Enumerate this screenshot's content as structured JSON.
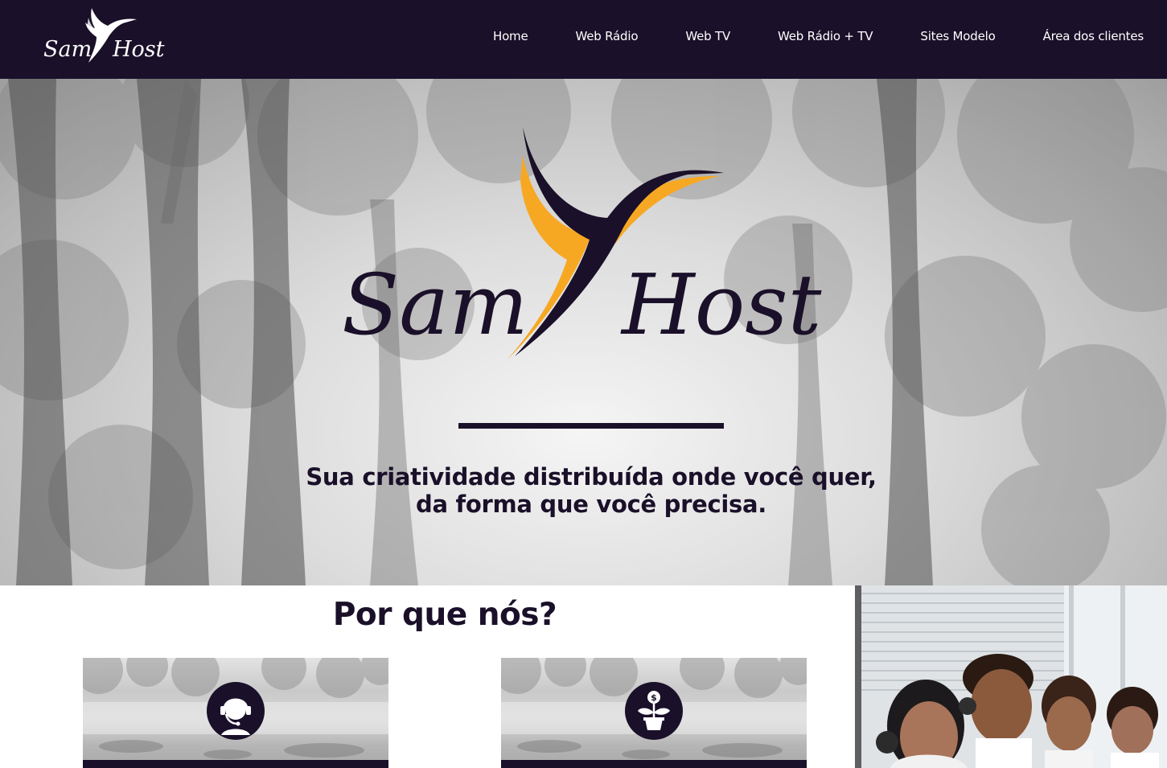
{
  "nav": {
    "logo_text": [
      "Sam",
      "Host"
    ],
    "links": [
      {
        "label": "Home"
      },
      {
        "label": "Web Rádio"
      },
      {
        "label": "Web TV"
      },
      {
        "label": "Web Rádio + TV"
      },
      {
        "label": "Sites Modelo"
      },
      {
        "label": "Área dos clientes"
      }
    ]
  },
  "hero": {
    "logo_text": [
      "Sam",
      "Host"
    ],
    "tagline_line1": "Sua criatividade distribuída onde você quer,",
    "tagline_line2": "da forma que você precisa."
  },
  "why": {
    "title": "Por que nós?",
    "features": [
      {
        "icon": "headset-support-icon"
      },
      {
        "icon": "money-plant-icon"
      }
    ]
  },
  "colors": {
    "navy": "#1a1029",
    "gold": "#f7a823",
    "white": "#ffffff"
  }
}
